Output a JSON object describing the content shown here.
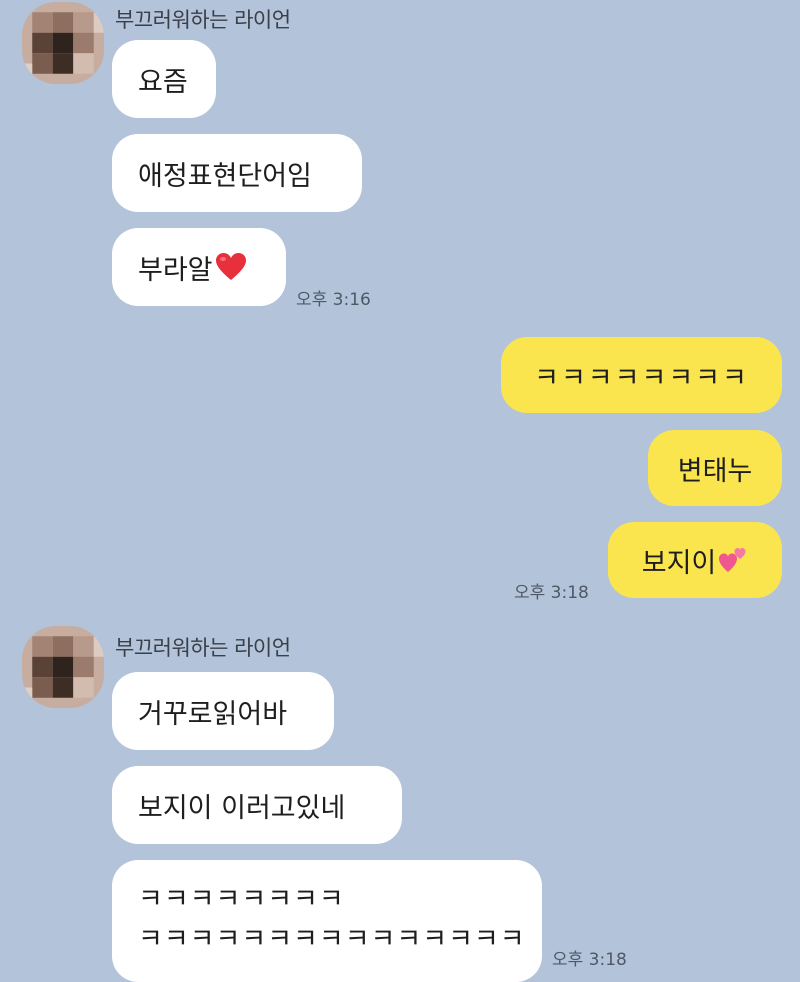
{
  "chat": {
    "colors": {
      "background": "#b3c3d9",
      "incoming_bubble": "#ffffff",
      "outgoing_bubble": "#fbe54f",
      "heart": "#e8303c",
      "pink_hearts": "#f0568f"
    },
    "group1": {
      "sender": "부끄러워하는 라이언",
      "avatar": "pixelated-avatar",
      "messages": [
        {
          "text": "요즘"
        },
        {
          "text": "애정표현단어임"
        },
        {
          "text": "부라알",
          "emoji": "red-heart-icon"
        }
      ],
      "time": "오후 3:16"
    },
    "group2": {
      "messages": [
        {
          "text": "ㅋㅋㅋㅋㅋㅋㅋㅋ"
        },
        {
          "text": "변태누"
        },
        {
          "text": "보지이",
          "emoji": "two-hearts-icon"
        }
      ],
      "time": "오후 3:18"
    },
    "group3": {
      "sender": "부끄러워하는 라이언",
      "avatar": "pixelated-avatar",
      "messages": [
        {
          "text": "거꾸로읽어바"
        },
        {
          "text": "보지이 이러고있네"
        },
        {
          "lines": [
            "ㅋㅋㅋㅋㅋㅋㅋㅋ",
            "ㅋㅋㅋㅋㅋㅋㅋㅋㅋㅋㅋㅋㅋㅋㅋ"
          ]
        }
      ],
      "time": "오후 3:18"
    }
  }
}
